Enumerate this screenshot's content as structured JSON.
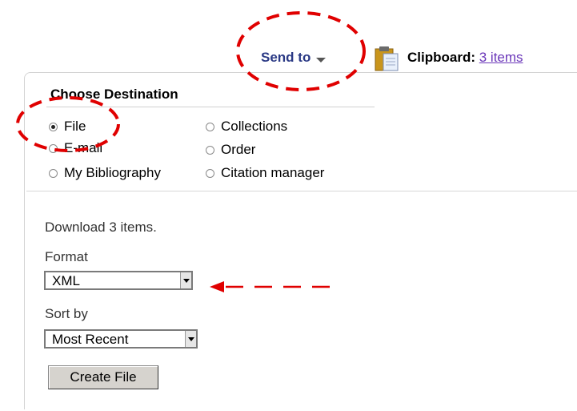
{
  "header": {
    "send_to_label": "Send to",
    "clipboard_label": "Clipboard:",
    "clipboard_count": "3 items"
  },
  "destination": {
    "title": "Choose Destination",
    "options": [
      {
        "label": "File",
        "checked": true
      },
      {
        "label": "E-mail",
        "checked": false
      },
      {
        "label": "My Bibliography",
        "checked": false
      },
      {
        "label": "Collections",
        "checked": false
      },
      {
        "label": "Order",
        "checked": false
      },
      {
        "label": "Citation manager",
        "checked": false
      }
    ]
  },
  "file_options": {
    "download_text": "Download 3 items.",
    "format_label": "Format",
    "format_value": "XML",
    "sort_label": "Sort by",
    "sort_value": "Most Recent",
    "create_button": "Create File"
  },
  "colors": {
    "send_to": "#2b3a85",
    "link": "#6a36b9",
    "annotation": "#e00000"
  },
  "icons": [
    "chevron-down-icon",
    "clipboard-icon",
    "chevron-down-icon"
  ]
}
